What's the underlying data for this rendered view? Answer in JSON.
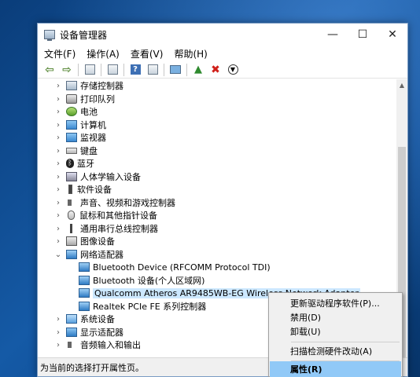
{
  "window": {
    "title": "设备管理器",
    "minimize": "—",
    "maximize": "☐",
    "close": "✕"
  },
  "menu": {
    "file": "文件(F)",
    "action": "操作(A)",
    "view": "查看(V)",
    "help": "帮助(H)"
  },
  "toolbar": {
    "back_icon": "arrow-left-icon",
    "forward_icon": "arrow-right-icon"
  },
  "tree": {
    "storage": "存储控制器",
    "print_queue": "打印队列",
    "battery": "电池",
    "computer": "计算机",
    "monitors": "监视器",
    "keyboard": "键盘",
    "bluetooth": "蓝牙",
    "hid": "人体学输入设备",
    "software": "软件设备",
    "sound": "声音、视频和游戏控制器",
    "mouse": "鼠标和其他指针设备",
    "usb": "通用串行总线控制器",
    "imaging": "图像设备",
    "network": "网络适配器",
    "net_bt_rfcomm": "Bluetooth Device (RFCOMM Protocol TDI)",
    "net_bt_pan": "Bluetooth 设备(个人区域网)",
    "net_qualcomm": "Qualcomm Atheros AR9485WB-EG Wireless Network Adapter",
    "net_realtek": "Realtek PCIe FE 系列控制器",
    "system": "系统设备",
    "display": "显示适配器",
    "audio_io": "音频输入和输出"
  },
  "status": "为当前的选择打开属性页。",
  "context_menu": {
    "update_driver": "更新驱动程序软件(P)...",
    "disable": "禁用(D)",
    "uninstall": "卸载(U)",
    "scan": "扫描检测硬件改动(A)",
    "properties": "属性(R)"
  }
}
